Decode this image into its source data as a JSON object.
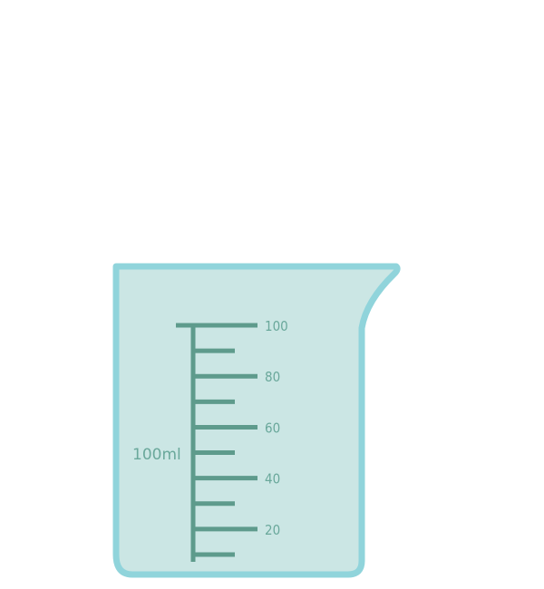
{
  "beaker": {
    "capacity_label": "100ml",
    "scale": {
      "major_ticks": [
        {
          "value": 100,
          "label": "100"
        },
        {
          "value": 80,
          "label": "80"
        },
        {
          "value": 60,
          "label": "60"
        },
        {
          "value": 40,
          "label": "40"
        },
        {
          "value": 20,
          "label": "20"
        }
      ],
      "minor_ticks": [
        90,
        70,
        50,
        30,
        10
      ]
    },
    "colors": {
      "outline": "#90d4db",
      "fill": "#cbe6e4",
      "scale": "#5e9b8c",
      "label": "#6aa89b"
    }
  }
}
